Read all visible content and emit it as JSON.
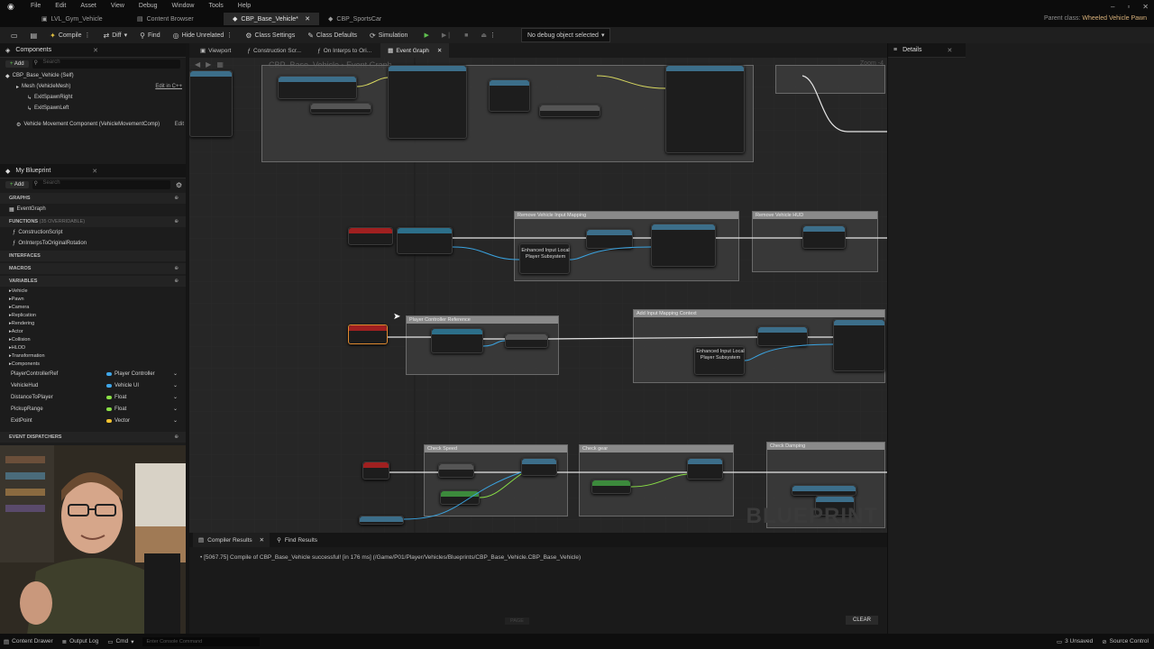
{
  "titlebar": {
    "menu": [
      "File",
      "Edit",
      "Asset",
      "View",
      "Debug",
      "Window",
      "Tools",
      "Help"
    ],
    "tabs": [
      {
        "label": "LVL_Gym_Vehicle",
        "active": false
      },
      {
        "label": "Content Browser",
        "active": false
      },
      {
        "label": "CBP_Base_Vehicle*",
        "active": true
      },
      {
        "label": "CBP_SportsCar",
        "active": false
      }
    ],
    "parent_class_label": "Parent class:",
    "parent_class_value": "Wheeled Vehicle Pawn"
  },
  "toolbar": {
    "compile": "Compile",
    "diff": "Diff",
    "find": "Find",
    "hide_unrelated": "Hide Unrelated",
    "class_settings": "Class Settings",
    "class_defaults": "Class Defaults",
    "simulation": "Simulation",
    "debug_object": "No debug object selected"
  },
  "components_panel": {
    "tab": "Components",
    "add": "Add",
    "search_placeholder": "Search",
    "items": [
      {
        "label": "CBP_Base_Vehicle (Self)",
        "indent": 0
      },
      {
        "label": "Mesh (VehicleMesh)",
        "indent": 1,
        "extra": "Edit in C++"
      },
      {
        "label": "ExitSpawnRight",
        "indent": 2
      },
      {
        "label": "ExitSpawnLeft",
        "indent": 2
      },
      {
        "label": "Vehicle Movement Component (VehicleMovementComp)",
        "indent": 1,
        "extra": "Edit"
      }
    ]
  },
  "my_blueprint": {
    "tab": "My Blueprint",
    "add": "Add",
    "search_placeholder": "Search",
    "graphs_header": "GRAPHS",
    "event_graph": "EventGraph",
    "functions_header": "FUNCTIONS",
    "functions_note": "(35 OVERRIDABLE)",
    "functions": [
      "ConstructionScript",
      "OnInterpsToOriginalRotation"
    ],
    "interfaces_header": "INTERFACES",
    "macros_header": "MACROS",
    "variables_header": "VARIABLES",
    "categories": [
      "Vehicle",
      "Pawn",
      "Camera",
      "Replication",
      "Rendering",
      "Actor",
      "Collision",
      "HLOD",
      "Transformation",
      "Components"
    ],
    "variables": [
      {
        "name": "PlayerControllerRef",
        "type": "Player Controller",
        "color": "#3fa6e8"
      },
      {
        "name": "VehicleHud",
        "type": "Vehicle UI",
        "color": "#3fa6e8"
      },
      {
        "name": "DistanceToPlayer",
        "type": "Float",
        "color": "#8ae046"
      },
      {
        "name": "PickupRange",
        "type": "Float",
        "color": "#8ae046"
      },
      {
        "name": "ExitPoint",
        "type": "Vector",
        "color": "#f2c230"
      }
    ],
    "event_dispatchers_header": "EVENT DISPATCHERS"
  },
  "graph": {
    "tabs": [
      {
        "label": "Viewport",
        "active": false
      },
      {
        "label": "Construction Scr...",
        "active": false
      },
      {
        "label": "On Interps to Ori...",
        "active": false
      },
      {
        "label": "Event Graph",
        "active": true
      }
    ],
    "breadcrumb_title": "CBP_Base_Vehicle",
    "breadcrumb_sub": "Event Graph",
    "zoom": "Zoom -4",
    "watermark": "BLUEPRINT",
    "comments": [
      "Remove Vehicle Input Mapping",
      "Remove Vehicle HUD",
      "Player Controller Reference",
      "Add Input Mapping Context",
      "Check Speed",
      "Check gear",
      "Check Damping"
    ],
    "subsystem_label": "Enhanced Input Local Player Subsystem"
  },
  "compiler": {
    "tabs": [
      "Compiler Results",
      "Find Results"
    ],
    "log": "[5067.75] Compile of CBP_Base_Vehicle successful! [in 176 ms] (/Game/P01/Player/Vehicles/Blueprints/CBP_Base_Vehicle.CBP_Base_Vehicle)",
    "page": "PAGE",
    "clear": "CLEAR"
  },
  "details": {
    "tab": "Details"
  },
  "statusbar": {
    "content_drawer": "Content Drawer",
    "output_log": "Output Log",
    "cmd": "Cmd",
    "console_placeholder": "Enter Console Command",
    "unsaved": "3 Unsaved",
    "source_control": "Source Control"
  }
}
